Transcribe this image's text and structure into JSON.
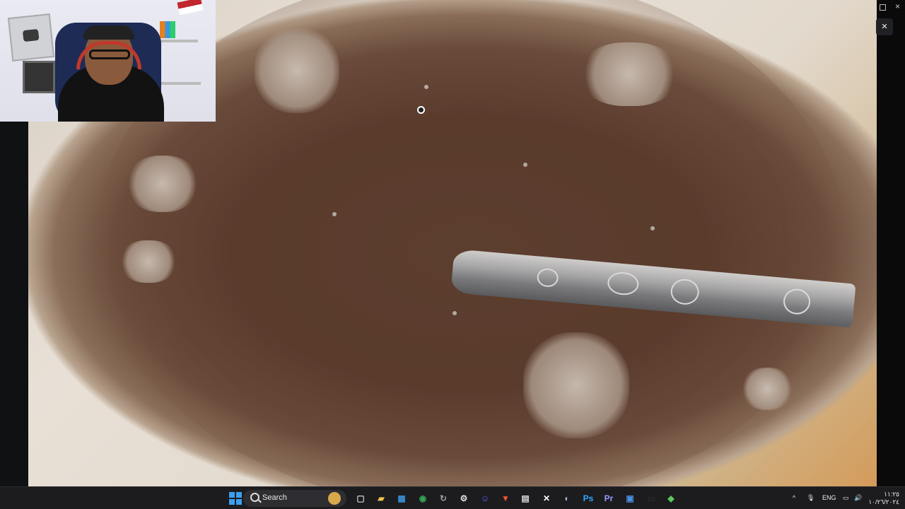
{
  "viewer": {
    "close_label": "×"
  },
  "taskbar": {
    "search_label": "Search",
    "items": [
      {
        "name": "task-view-icon",
        "glyph": "▢",
        "color": "#cfcfcf"
      },
      {
        "name": "file-explorer-icon",
        "glyph": "▰",
        "color": "#f2c14e"
      },
      {
        "name": "microsoft-store-icon",
        "glyph": "▦",
        "color": "#3a8fd9"
      },
      {
        "name": "chrome-icon",
        "glyph": "◉",
        "color": "#34a853"
      },
      {
        "name": "sync-app-icon",
        "glyph": "↻",
        "color": "#9e9e9e"
      },
      {
        "name": "settings-icon",
        "glyph": "⚙",
        "color": "#e0e0e0"
      },
      {
        "name": "discord-icon",
        "glyph": "☺",
        "color": "#5865f2"
      },
      {
        "name": "brave-icon",
        "glyph": "▼",
        "color": "#fb542b"
      },
      {
        "name": "image-viewer-icon",
        "glyph": "▤",
        "color": "#dcdcdc"
      },
      {
        "name": "capcut-icon",
        "glyph": "✕",
        "color": "#ffffff"
      },
      {
        "name": "steam-icon",
        "glyph": "◐",
        "color": "#9fb7d4"
      },
      {
        "name": "photoshop-icon",
        "glyph": "Ps",
        "color": "#31a8ff"
      },
      {
        "name": "premiere-icon",
        "glyph": "Pr",
        "color": "#9999ff"
      },
      {
        "name": "photos-icon",
        "glyph": "▣",
        "color": "#4a90e2"
      },
      {
        "name": "blank-app-icon",
        "glyph": "▭",
        "color": "#2a2a2a"
      },
      {
        "name": "cube-app-icon",
        "glyph": "◆",
        "color": "#5cc75c"
      }
    ],
    "tray": {
      "chevron": "^",
      "mic": "🎙",
      "language": "ENG",
      "network": "▭",
      "volume": "🔊",
      "clock_time": "١١:٢٥",
      "clock_date": "١٠/٢٦/٢٠٢٤"
    }
  },
  "colors": {
    "taskbar_bg": "#1c1c1f",
    "accent": "#3aa0f2"
  }
}
